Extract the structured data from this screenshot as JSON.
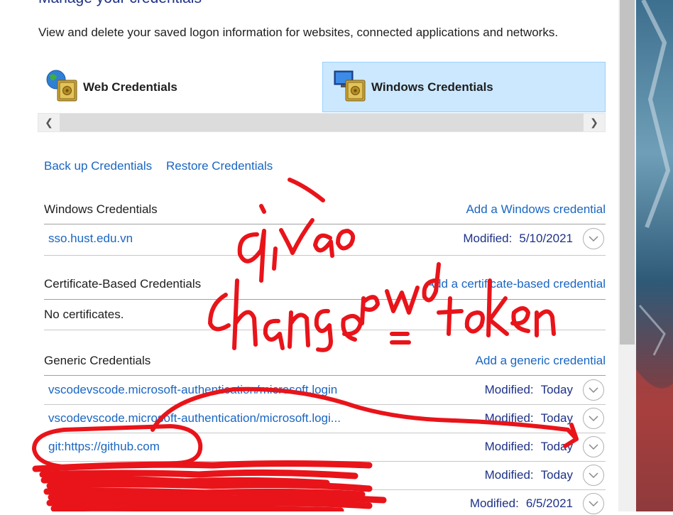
{
  "header": {
    "title": "Manage your credentials",
    "description": "View and delete your saved logon information for websites, connected applications and networks."
  },
  "tabs": [
    {
      "label": "Web Credentials",
      "icon": "web-credentials-vault-icon",
      "selected": false
    },
    {
      "label": "Windows Credentials",
      "icon": "windows-credentials-vault-icon",
      "selected": true
    }
  ],
  "actions": {
    "backup": "Back up Credentials",
    "restore": "Restore Credentials"
  },
  "modified_label": "Modified:",
  "sections": {
    "windows": {
      "title": "Windows Credentials",
      "add": "Add a Windows credential",
      "items": [
        {
          "name": "sso.hust.edu.vn",
          "modified": "5/10/2021"
        }
      ]
    },
    "certificate": {
      "title": "Certificate-Based Credentials",
      "add": "Add a certificate-based credential",
      "empty": "No certificates."
    },
    "generic": {
      "title": "Generic Credentials",
      "add": "Add a generic credential",
      "items": [
        {
          "name": "vscodevscode.microsoft-authentication/microsoft.login",
          "modified": "Today"
        },
        {
          "name": "vscodevscode.microsoft-authentication/microsoft.logi...",
          "modified": "Today"
        },
        {
          "name": "git:https://github.com",
          "modified": "Today"
        },
        {
          "name": "",
          "modified": "Today"
        },
        {
          "name": "",
          "modified": "6/5/2021"
        }
      ]
    }
  },
  "annotation": {
    "line1": "đi vào",
    "line2": "change pwd = token",
    "color": "#e8141a"
  },
  "colors": {
    "link": "#1a66c2",
    "selected_tab_bg": "#cce8ff",
    "title": "#1e3287"
  }
}
